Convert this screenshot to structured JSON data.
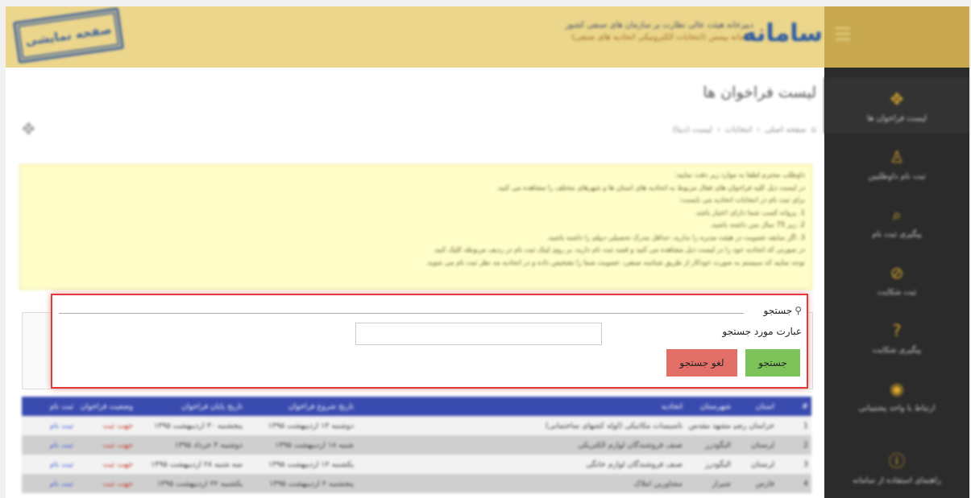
{
  "header": {
    "stamp_text": "صفحه نمایشی",
    "brand_line1": "دبیرخانه هیئت عالی نظارت بر سازمان های صنفی کشور",
    "brand_line2": "سامانه پیمس (انتخابات الکترونیکی اتحادیه های صنفی)",
    "logo_text": "سامانه"
  },
  "sidebar": {
    "items": [
      {
        "label": "لیست فراخوان ها",
        "icon": "✥"
      },
      {
        "label": "ثبت نام داوطلبین",
        "icon": "♙"
      },
      {
        "label": "پیگیری ثبت نام",
        "icon": "⌕"
      },
      {
        "label": "ثبت شکایت",
        "icon": "⊘"
      },
      {
        "label": "پیگیری شکایت",
        "icon": "?"
      },
      {
        "label": "ارتباط با واحد پشتیبانی",
        "icon": "◉"
      },
      {
        "label": "راهنمای استفاده از سامانه",
        "icon": "ⓘ"
      }
    ]
  },
  "page": {
    "title": "لیست فراخوان ها",
    "breadcrumb": [
      "صفحه اصلی",
      "انتخابات",
      "لیست (دیتا)"
    ]
  },
  "notice": {
    "lines": [
      "داوطلب محترم لطفا به موارد زیر دقت نمایید:",
      "در لیست ذیل کلیه فراخوان های فعال مربوط به اتحادیه های استان ها و شهرهای مختلف را مشاهده می کنید.",
      "برای ثبت نام در انتخابات اتحادیه می بایست:",
      "1. پروانه کسب شما دارای اعتبار باشد.",
      "2. زیر 75 سال سن داشته باشید.",
      "3. اگر سابقه عضویت در هیئت مدیره را ندارید، حداقل مدرک تحصیلی دیپلم را داشته باشید.",
      "در صورتی که اتحادیه خود را در لیست ذیل مشاهده می کنید و قصد ثبت نام دارید، بر روی لینک ثبت نام در ردیف مربوطه کلیک کنید.",
      "توجه نمایید که سیستم به صورت خودکار از طریق شناسه صنفی، عضویت شما را تشخیص داده و در اتحادیه مد نظر ثبت نام می شوید."
    ]
  },
  "search": {
    "legend": "جستجو",
    "field_label": "عبارت مورد جستجو",
    "input_value": "",
    "input_placeholder": "",
    "search_button": "جستجو",
    "cancel_button": "لغو جستجو"
  },
  "table": {
    "headers": [
      "#",
      "استان",
      "شهرستان",
      "اتحادیه",
      "تاریخ شروع فراخوان",
      "تاریخ پایان فراخوان",
      "وضعیت فراخوان",
      "ثبت نام"
    ],
    "rows": [
      [
        "1",
        "خراسان رضوی",
        "مشهد مقدس",
        "تاسیسات مکانیکی (لوله کشهای ساختمانی)",
        "دوشنبه ۱۳ اردیبهشت ۱۳۹۵",
        "پنجشنبه ۳۰ اردیبهشت ۱۳۹۵",
        "جهت ثبت",
        "ثبت نام"
      ],
      [
        "2",
        "لرستان",
        "الیگودرز",
        "صنف فروشندگان لوازم الکتریکی",
        "شنبه ۱۸ اردیبهشت ۱۳۹۵",
        "دوشنبه ۳ خرداد ۱۳۹۵",
        "جهت ثبت",
        "ثبت نام"
      ],
      [
        "3",
        "لرستان",
        "الیگودرز",
        "صنف فروشندگان لوازم خانگی",
        "یکشنبه ۱۲ اردیبهشت ۱۳۹۵",
        "سه شنبه ۲۸ اردیبهشت ۱۳۹۵",
        "جهت ثبت",
        "ثبت نام"
      ],
      [
        "4",
        "فارس",
        "شیراز",
        "مشاورین املاک",
        "پنجشنبه ۲ اردیبهشت ۱۳۹۵",
        "یکشنبه ۲۲ اردیبهشت ۱۳۹۵",
        "جهت ثبت",
        "ثبت نام"
      ]
    ]
  }
}
